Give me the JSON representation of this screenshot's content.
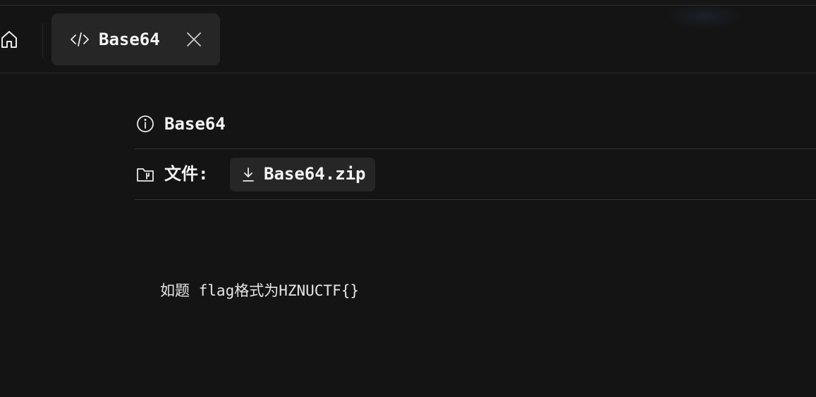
{
  "tab": {
    "label": "Base64"
  },
  "challenge": {
    "title": "Base64",
    "files_label": "文件:",
    "file_name": "Base64.zip",
    "description": "如题 flag格式为HZNUCTF{}"
  },
  "icons": {
    "home": "home-icon",
    "code": "code-icon",
    "close": "close-icon",
    "info": "info-icon",
    "folder": "folder-icon",
    "download": "download-icon"
  },
  "colors": {
    "background": "#141414",
    "surface": "#262626",
    "divider": "#333333",
    "text": "#f4f4f4"
  }
}
